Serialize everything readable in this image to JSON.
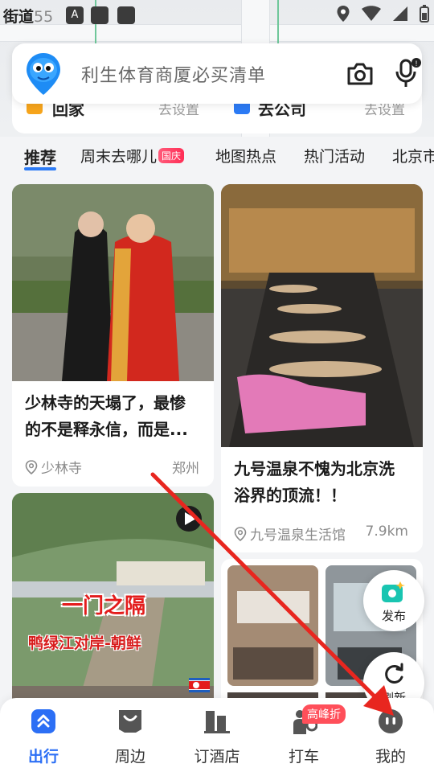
{
  "status_bar": {
    "time_main": "街道",
    "time_faded": "55"
  },
  "search": {
    "placeholder": "利生体育商厦必买清单"
  },
  "address_card": {
    "home_label": "回家",
    "home_set": "去设置",
    "company_label": "去公司",
    "company_set": "去设置"
  },
  "tabs": [
    {
      "label": "推荐",
      "active": true
    },
    {
      "label": "周末去哪儿",
      "badge": "国庆"
    },
    {
      "label": "地图热点"
    },
    {
      "label": "热门活动"
    },
    {
      "label": "北京市"
    }
  ],
  "feed": [
    {
      "title_line1": "少林寺的天塌了，最惨",
      "title_line2": "的不是释永信，而是...",
      "location": "少林寺",
      "distance": "郑州"
    },
    {
      "title_line1": "九号温泉不愧为北京洗",
      "title_line2": "浴界的顶流！！",
      "location": "九号温泉生活馆",
      "distance": "7.9km"
    },
    {
      "overlay_line1": "一门之隔",
      "overlay_line2": "鸭绿江对岸-朝鲜"
    }
  ],
  "float_buttons": {
    "publish": "发布",
    "refresh": "刷新"
  },
  "bottom_nav": [
    {
      "label": "出行",
      "icon": "travel-icon",
      "active": true
    },
    {
      "label": "周边",
      "icon": "nearby-icon"
    },
    {
      "label": "订酒店",
      "icon": "hotel-icon"
    },
    {
      "label": "打车",
      "icon": "taxi-icon",
      "badge": "高峰折"
    },
    {
      "label": "我的",
      "icon": "profile-icon"
    }
  ],
  "colors": {
    "accent": "#2c6ff5",
    "badge": "#ff4f5a",
    "arrow": "#e8261f"
  }
}
